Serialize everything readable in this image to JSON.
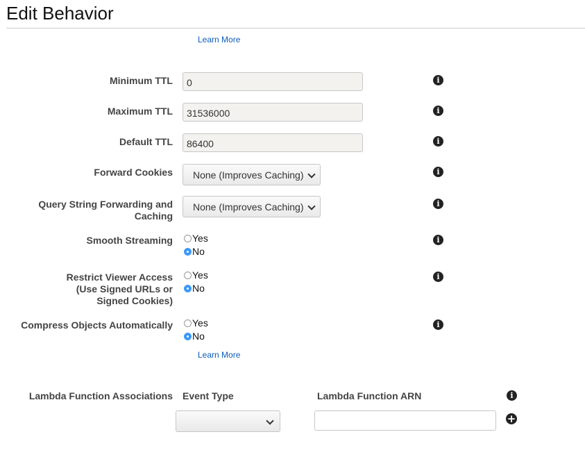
{
  "title": "Edit Behavior",
  "learn_more": "Learn More",
  "fields": {
    "min_ttl": {
      "label": "Minimum TTL",
      "value": "0"
    },
    "max_ttl": {
      "label": "Maximum TTL",
      "value": "31536000"
    },
    "default_ttl": {
      "label": "Default TTL",
      "value": "86400"
    },
    "forward_cookies": {
      "label": "Forward Cookies",
      "value": "None (Improves Caching)"
    },
    "query_string": {
      "label_1": "Query String Forwarding and",
      "label_2": "Caching",
      "value": "None (Improves Caching)"
    },
    "smooth_streaming": {
      "label": "Smooth Streaming",
      "selected": "No"
    },
    "restrict_viewer": {
      "label_1": "Restrict Viewer Access",
      "label_2": "(Use Signed URLs or",
      "label_3": "Signed Cookies)",
      "selected": "No"
    },
    "compress": {
      "label": "Compress Objects Automatically",
      "selected": "No"
    }
  },
  "radio": {
    "yes": "Yes",
    "no": "No"
  },
  "lambda": {
    "label": "Lambda Function Associations",
    "event_type": "Event Type",
    "arn": "Lambda Function ARN",
    "event_value": "",
    "arn_value": ""
  },
  "icons": {
    "info": "info-icon",
    "add": "plus-circle-icon",
    "dropdown": "chevron-down-icon"
  },
  "colors": {
    "link": "#0b5bb5",
    "radio_selected": "#3b99fc"
  }
}
